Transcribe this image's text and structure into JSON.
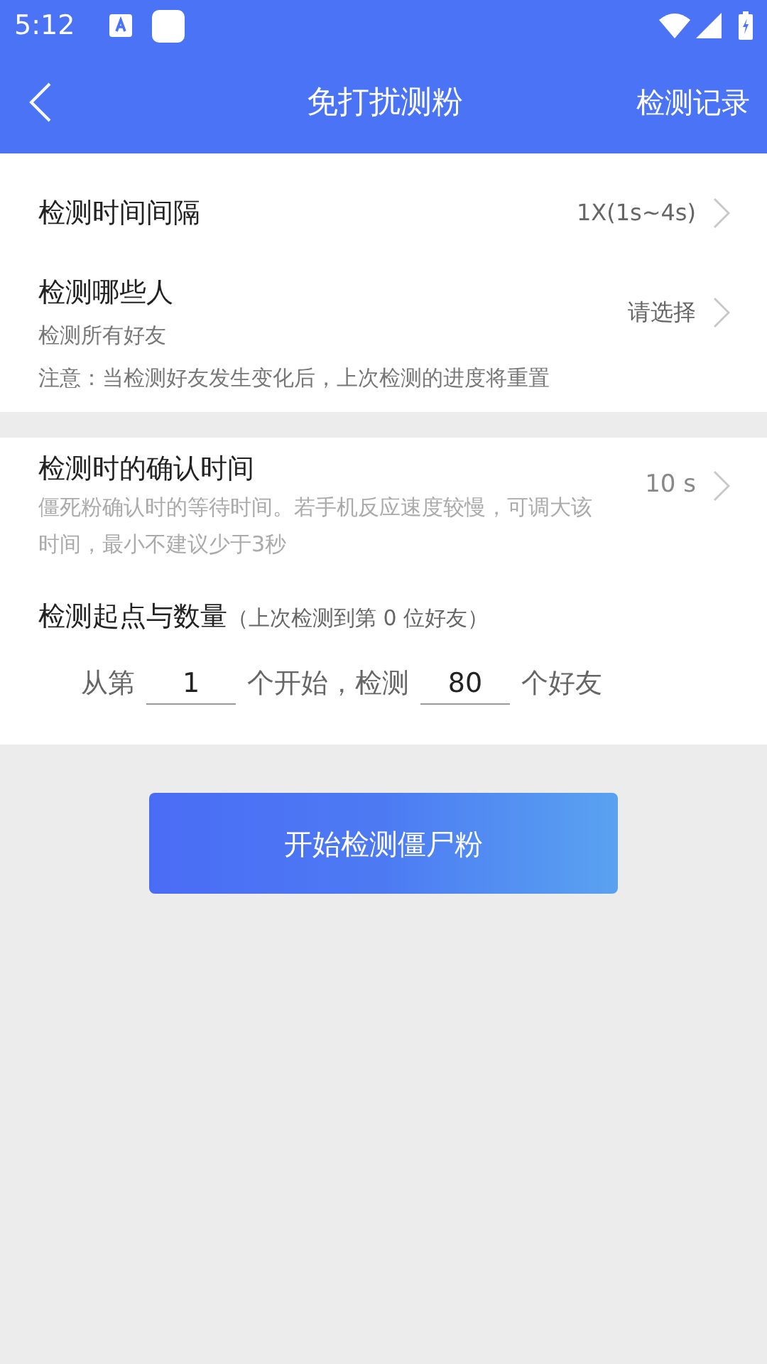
{
  "status_bar": {
    "time": "5:12"
  },
  "header": {
    "title": "免打扰测粉",
    "action": "检测记录"
  },
  "settings": [
    {
      "kind": "simple",
      "label": "检测时间间隔",
      "value": "1X(1s~4s)"
    },
    {
      "kind": "detail",
      "label": "检测哪些人",
      "description": "检测所有好友",
      "value": "请选择",
      "note": "注意：当检测好友发生变化后，上次检测的进度将重置"
    }
  ],
  "confirm": {
    "label": "检测时的确认时间",
    "description": "僵死粉确认时的等待时间。若手机反应速度较慢，可调大该时间，最小不建议少于3秒",
    "value": "10 s"
  },
  "range": {
    "label": "检测起点与数量",
    "hint": "（上次检测到第 0 位好友）",
    "prefix": "从第",
    "start": "1",
    "middle": "个开始，检测",
    "count": "80",
    "suffix": "个好友"
  },
  "start_button": "开始检测僵尸粉"
}
